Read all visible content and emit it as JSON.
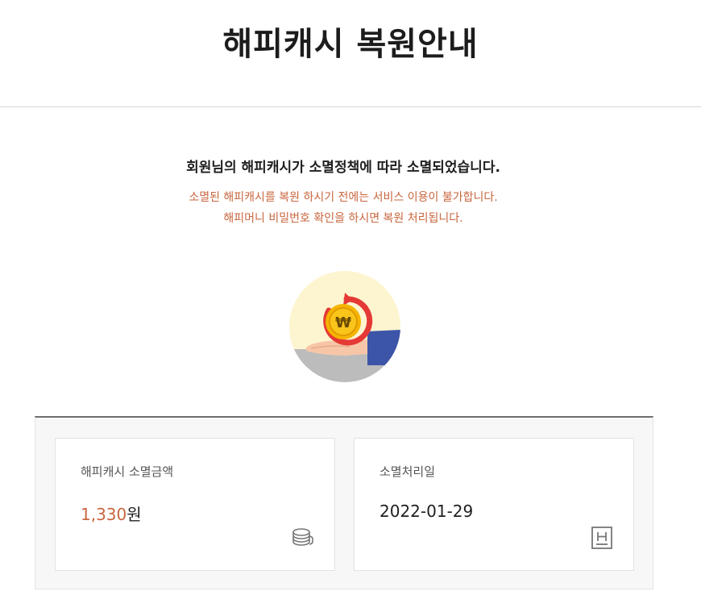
{
  "header": {
    "title": "해피캐시 복원안내"
  },
  "notice": {
    "main": "회원님의 해피캐시가 소멸정책에 따라 소멸되었습니다.",
    "sub_line1": "소멸된 해피캐시를 복원 하시기 전에는 서비스 이용이 불가합니다.",
    "sub_line2": "해피머니 비밀번호 확인을 하시면 복원 처리됩니다."
  },
  "illustration": {
    "coin_symbol": "₩",
    "icon": "restore-coin-hand-icon",
    "colors": {
      "circle_bg": "#fdf5d0",
      "coin": "#f5b400",
      "arrow": "#e53935",
      "sleeve": "#3d55a8",
      "hand": "#f7c6a8",
      "ground": "#bcbcbc"
    }
  },
  "summary": {
    "amount_card": {
      "label": "해피캐시 소멸금액",
      "value_number": "1,330",
      "value_unit": "원",
      "icon": "coin-stack-icon"
    },
    "date_card": {
      "label": "소멸처리일",
      "value": "2022-01-29",
      "icon": "calendar-h-icon"
    }
  },
  "colors": {
    "accent": "#c8663f",
    "text": "#222222",
    "panel_bg": "#f7f7f7"
  }
}
